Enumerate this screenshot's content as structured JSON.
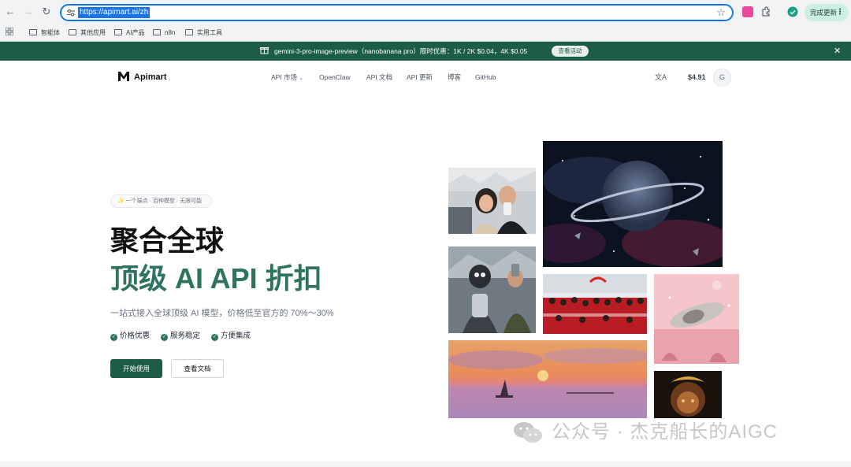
{
  "browser": {
    "url": "https://apimart.ai/zh",
    "update_label": "完成更新",
    "bookmarks": [
      "智能体",
      "其他应用",
      "AI产品",
      "n8n",
      "实用工具"
    ]
  },
  "banner": {
    "text": "gemini-3-pro-image-preview（nanobanana pro）限时优惠：1K / 2K $0.04，4K $0.05",
    "button_label": "查看活动"
  },
  "header": {
    "logo_text": "Apimart",
    "nav": [
      "API 市场",
      "OpenClaw",
      "API 文档",
      "API 更新",
      "博客",
      "GitHub"
    ],
    "balance": "$4.91",
    "avatar_initial": "G"
  },
  "hero": {
    "tag": "✨ 一个端点 · 百种模型 · 无限可能",
    "title_line1": "聚合全球",
    "title_line2": "顶级 AI API 折扣",
    "subtitle": "一站式接入全球顶级 AI 模型，价格低至官方的 70%～30%",
    "features": [
      "价格优惠",
      "服务稳定",
      "方便集成"
    ],
    "primary_button": "开始使用",
    "secondary_button": "查看文档"
  },
  "watermark": {
    "text": "公众号 · 杰克船长的AIGC"
  },
  "colors": {
    "brand_green": "#1d5d48",
    "title_green": "#2d7360",
    "selection_blue": "#1a73e8"
  }
}
